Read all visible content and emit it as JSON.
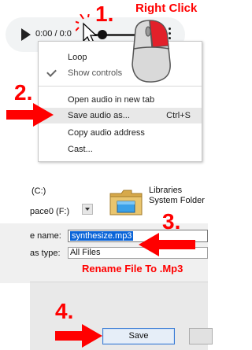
{
  "player": {
    "time": "0:00 / 0:0"
  },
  "context_menu": {
    "items": [
      {
        "label": "Loop",
        "shortcut": ""
      },
      {
        "label": "Show controls",
        "shortcut": ""
      },
      {
        "label": "Open audio in new tab",
        "shortcut": ""
      },
      {
        "label": "Save audio as...",
        "shortcut": "Ctrl+S"
      },
      {
        "label": "Copy audio address",
        "shortcut": ""
      },
      {
        "label": "Cast...",
        "shortcut": ""
      }
    ]
  },
  "annotations": {
    "step1": "1.",
    "step1_text": "Right Click",
    "step2": "2.",
    "step3": "3.",
    "step3_text": "Rename File To .Mp3",
    "step4": "4.",
    "accent_color": "#ff0000"
  },
  "explorer": {
    "drive_c": "(C:)",
    "drive_f": "pace0 (F:)",
    "libraries_title": "Libraries",
    "libraries_sub": "System Folder"
  },
  "dialog": {
    "name_label": "e name:",
    "name_value": "synthesize.mp3",
    "type_label": "as type:",
    "type_value": "All Files",
    "save_label": "Save"
  }
}
